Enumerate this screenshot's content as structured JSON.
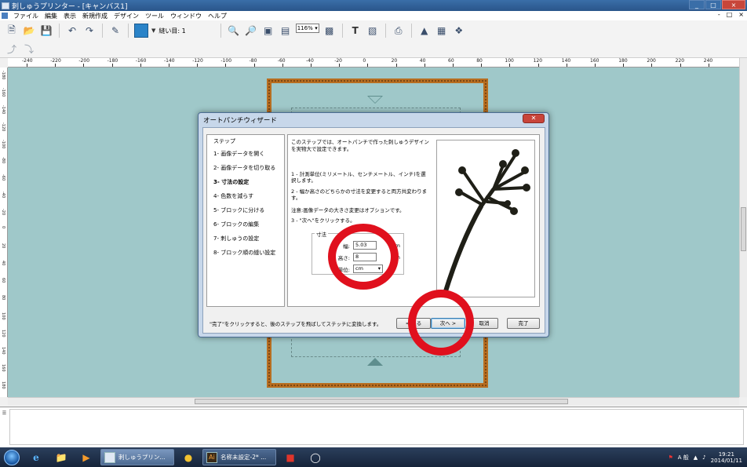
{
  "window": {
    "title": "刺しゅうプリンター - [キャンバス1]",
    "controls": [
      "_",
      "□",
      "×"
    ]
  },
  "menu": {
    "items": [
      "ファイル",
      "編集",
      "表示",
      "新規作成",
      "デザイン",
      "ツール",
      "ウィンドウ",
      "ヘルプ"
    ],
    "window_controls": [
      "-",
      "□",
      "×"
    ]
  },
  "toolbar": {
    "stitch_label": "縫い目: 1",
    "zoom_value": "116%",
    "color_swatch": "#2a83c8",
    "icons": [
      "new-file-icon",
      "open-folder-icon",
      "save-icon",
      "undo-icon",
      "redo-icon",
      "pen-icon",
      "color-swatch",
      "zoom-in-icon",
      "zoom-out-icon",
      "fit-icon",
      "actual-size-icon",
      "zoom-select",
      "export-icon",
      "text-icon",
      "transform-icon",
      "scan-icon",
      "upload-icon",
      "photo-icon",
      "tool-icon"
    ]
  },
  "ruler": {
    "h_labels": [
      "-240",
      "-220",
      "-200",
      "-180",
      "-160",
      "-140",
      "-120",
      "-100",
      "-80",
      "-60",
      "-40",
      "-20",
      "0",
      "20",
      "40",
      "60",
      "80",
      "100",
      "120",
      "140",
      "160",
      "180",
      "200",
      "220",
      "240"
    ],
    "v_labels": [
      "-180",
      "-160",
      "-140",
      "-120",
      "-100",
      "-80",
      "-60",
      "-40",
      "-20",
      "0",
      "20",
      "40",
      "60",
      "80",
      "100",
      "120",
      "140",
      "160",
      "180"
    ]
  },
  "canvas": {
    "background": "#9fc8c9",
    "hoop_color": "#b86e21"
  },
  "dialog": {
    "title": "オートパンチウィザード",
    "steps_title": "ステップ",
    "steps": [
      "1- 画像データを開く",
      "2- 画像データを切り取る",
      "3- 寸法の設定",
      "4- 色数を減らす",
      "5- ブロックに分ける",
      "6- ブロックの編集",
      "7- 刺しゅうの設定",
      "8- ブロック順の縫い設定"
    ],
    "active_step_index": 2,
    "description": "このステップでは、オートパンチで作った刺しゅうデザインを実物大で設定できます。",
    "instruction_1": "1 - 計測単位(ミリメートル、センチメートル、インチ)を選択します。",
    "instruction_2": "2 - 幅か高さのどちらかの寸法を変更すると両方共変わります。",
    "note": "注意:画像データの大きさ変更はオプションです。",
    "instruction_3": "3 - \"次へ\"をクリックする。",
    "size_group": {
      "legend": "寸法",
      "width_label": "幅:",
      "width_value": "5.03",
      "height_label": "高さ:",
      "height_value": "8",
      "unit_suffix": "cm",
      "unit_label": "単位:",
      "unit_value": "cm"
    },
    "footer_message": "\"完了\"をクリックすると、後のステップを飛ばしてステッチに変換します。",
    "buttons": {
      "back": "< 戻る",
      "next": "次へ >",
      "cancel": "取消",
      "finish": "完了"
    }
  },
  "annotation_color": "#e0101d",
  "taskbar": {
    "tasks": [
      {
        "label": "刺しゅうプリン...",
        "active": true
      },
      {
        "label": "名称未設定-2* ...",
        "active": false
      }
    ],
    "tray_text": "A 般",
    "time": "19:21",
    "date": "2014/01/11"
  }
}
